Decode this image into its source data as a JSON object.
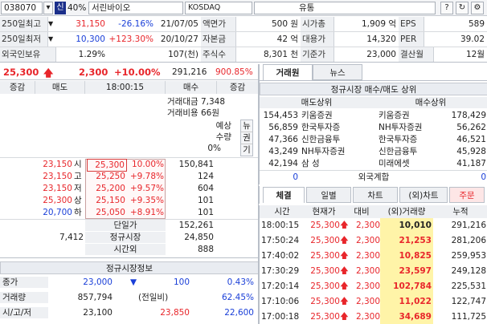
{
  "top": {
    "code": "038070",
    "badge": "신",
    "pct": "40%",
    "name": "서린바이오",
    "market": "KOSDAQ",
    "sector": "유통",
    "help": "?",
    "refresh": "↻",
    "gear": "⚙"
  },
  "info": {
    "rows": [
      {
        "l1": "250일최고",
        "v1": "31,150",
        "c1": "-26.16%",
        "d1": "21/07/05",
        "l2": "액면가",
        "v2": "500 원",
        "l3": "시가총",
        "v3": "1,909 억",
        "l4": "EPS",
        "v4": "589"
      },
      {
        "l1": "250일최저",
        "v1": "10,300",
        "c1": "+123.30%",
        "d1": "20/10/27",
        "l2": "자본금",
        "v2": "42 억",
        "l3": "대용가",
        "v3": "14,320",
        "l4": "PER",
        "v4": "39.02"
      },
      {
        "l1": "외국인보유",
        "v1": "1.29%",
        "c1": "",
        "d1": "107(천)",
        "l2": "주식수",
        "v2": "8,301 천",
        "l3": "기준가",
        "v3": "23,000",
        "l4": "결산월",
        "v4": "12월"
      }
    ]
  },
  "price": {
    "current": "25,300",
    "change": "2,300",
    "rate": "+10.00%",
    "volume": "291,216",
    "vol_rate": "900.85%"
  },
  "orderbook": {
    "headers": [
      "증감",
      "매도",
      "18:00:15",
      "매수",
      "증감"
    ],
    "summary_lines": [
      "거래대금 7,348",
      "거래비용 66원"
    ],
    "expect_labels": [
      "예상",
      "수량",
      "0%"
    ],
    "side_tabs": [
      "뉴",
      "권",
      "기"
    ],
    "asks": [
      {
        "qty": "23,150",
        "tag": "시",
        "price": "25,300",
        "rate": "10.00%",
        "bid": "150,841"
      },
      {
        "qty": "23,150",
        "tag": "고",
        "price": "25,250",
        "rate": "+9.78%",
        "bid": "124"
      },
      {
        "qty": "23,150",
        "tag": "저",
        "price": "25,200",
        "rate": "+9.57%",
        "bid": "604"
      },
      {
        "qty": "25,300",
        "tag": "상",
        "price": "25,150",
        "rate": "+9.35%",
        "bid": "101"
      },
      {
        "qty": "20,700",
        "tag": "하",
        "price": "25,050",
        "rate": "+8.91%",
        "bid": "101"
      }
    ],
    "footer": [
      {
        "left": "",
        "label": "단일가",
        "right": "152,261"
      },
      {
        "left": "7,412",
        "label": "정규시장",
        "right": "24,850"
      },
      {
        "left": "",
        "label": "시간외",
        "right": "888"
      }
    ]
  },
  "regular": {
    "title": "정규시장정보",
    "rows": [
      {
        "label": "종가",
        "v1": "23,000",
        "v2": "▼",
        "v3": "100",
        "v4": "0.43%"
      },
      {
        "label": "거래량",
        "v1": "857,794",
        "v2": "(전일비)",
        "v3": "",
        "v4": "62.45%"
      },
      {
        "label": "시/고/저",
        "v1": "23,100",
        "v2": "23,850",
        "v3": "",
        "v4": "22,600"
      }
    ]
  },
  "right": {
    "tabs": [
      "거래원",
      "뉴스"
    ],
    "title": "정규시장 매수/매도 상위",
    "sell_label": "매도상위",
    "buy_label": "매수상위",
    "brokers": [
      {
        "sq": "154,453",
        "sn": "키움증권",
        "bn": "키움증권",
        "bq": "178,429"
      },
      {
        "sq": "56,859",
        "sn": "한국투자증",
        "bn": "NH투자증권",
        "bq": "56,262"
      },
      {
        "sq": "47,366",
        "sn": "신한금융투",
        "bn": "한국투자증",
        "bq": "46,521"
      },
      {
        "sq": "43,249",
        "sn": "NH투자증권",
        "bn": "신한금융투",
        "bq": "45,928"
      },
      {
        "sq": "42,194",
        "sn": "삼 성",
        "bn": "미래에셋",
        "bq": "41,187"
      }
    ],
    "foreign": {
      "sq": "0",
      "label": "외국계합",
      "bq": "0"
    }
  },
  "ticks": {
    "tabs": [
      "체결",
      "일별",
      "차트",
      "(외)차트",
      "주문"
    ],
    "headers": [
      "시간",
      "현재가",
      "대비",
      "(외)거래량",
      "누적"
    ],
    "rows": [
      {
        "t": "18:00:15",
        "p": "25,300",
        "c": "2,300",
        "v": "10,010",
        "a": "291,216"
      },
      {
        "t": "17:50:24",
        "p": "25,300",
        "c": "2,300",
        "v": "21,253",
        "a": "281,206"
      },
      {
        "t": "17:40:02",
        "p": "25,300",
        "c": "2,300",
        "v": "10,825",
        "a": "259,953"
      },
      {
        "t": "17:30:29",
        "p": "25,300",
        "c": "2,300",
        "v": "23,597",
        "a": "249,128"
      },
      {
        "t": "17:20:14",
        "p": "25,300",
        "c": "2,300",
        "v": "102,784",
        "a": "225,531"
      },
      {
        "t": "17:10:06",
        "p": "25,300",
        "c": "2,300",
        "v": "11,022",
        "a": "122,747"
      },
      {
        "t": "17:00:18",
        "p": "25,300",
        "c": "2,300",
        "v": "34,689",
        "a": "111,725"
      }
    ]
  }
}
